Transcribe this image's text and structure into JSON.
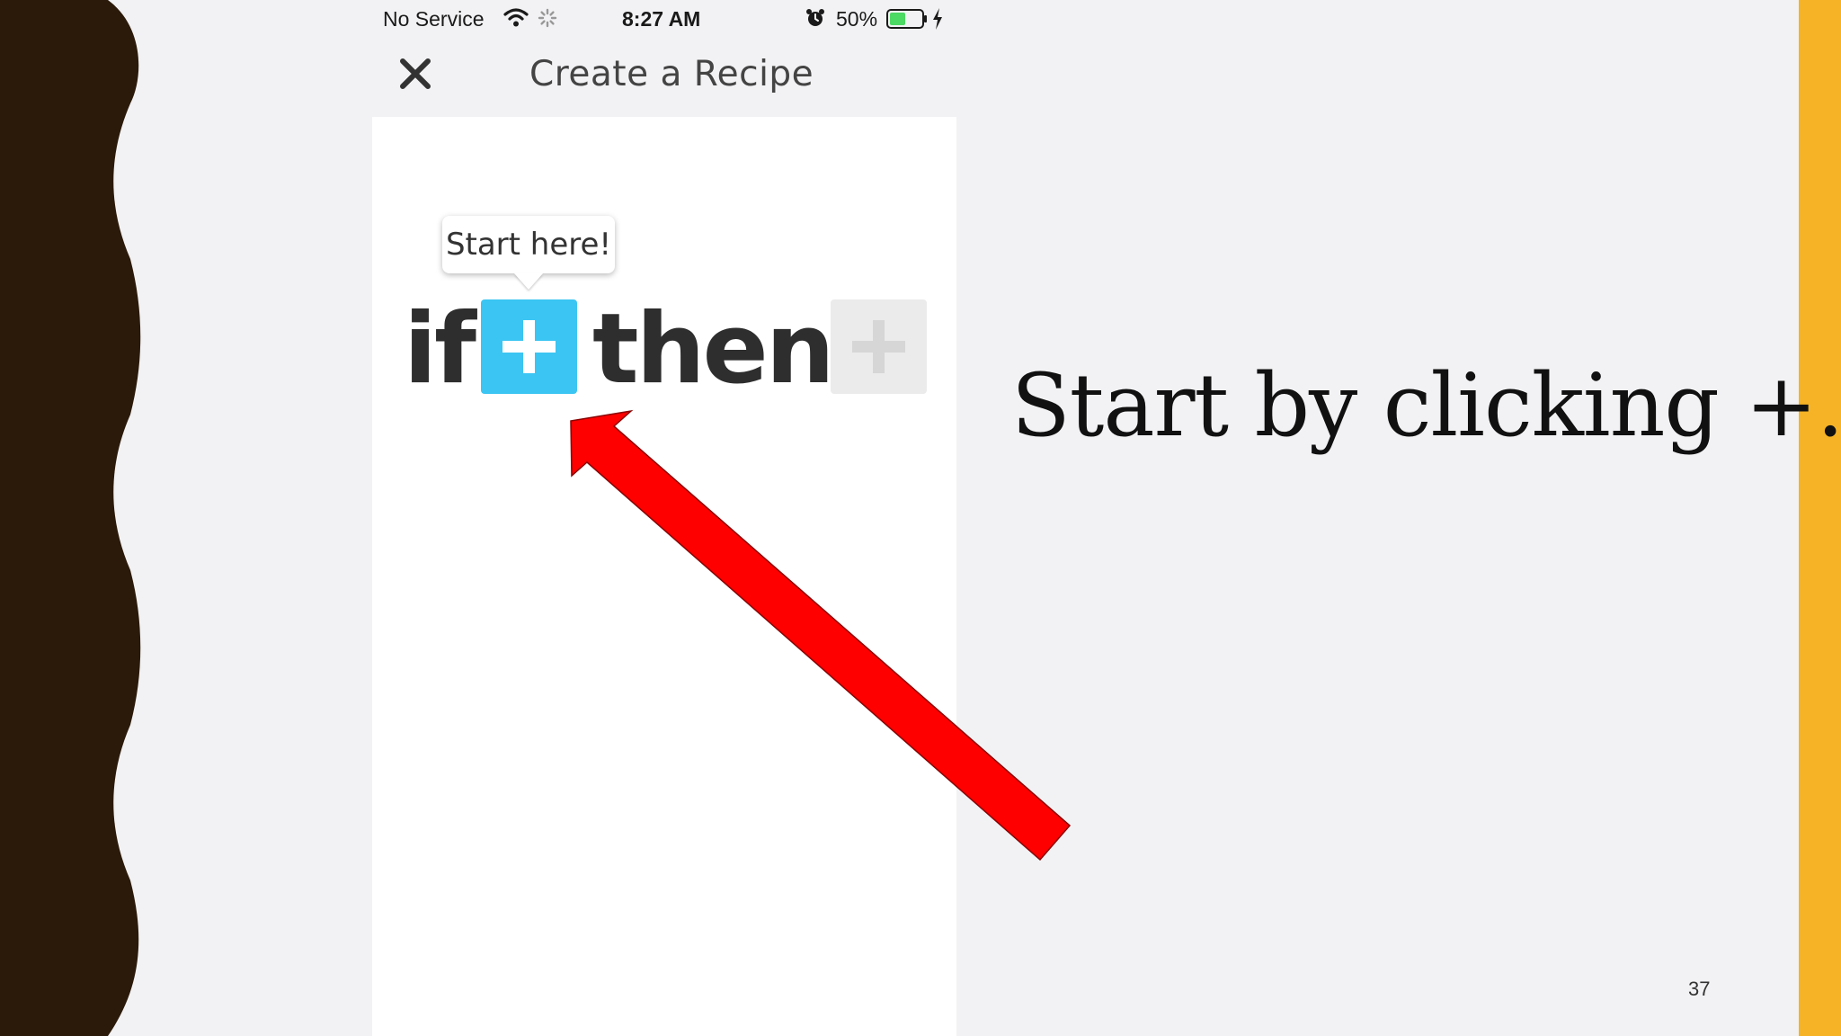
{
  "status_bar": {
    "carrier": "No Service",
    "time": "8:27 AM",
    "battery_percent": "50%",
    "battery_level": 0.5,
    "icons": [
      "wifi-icon",
      "loading-spinner-icon",
      "alarm-icon",
      "battery-icon",
      "charging-bolt-icon"
    ]
  },
  "nav": {
    "title": "Create a Recipe",
    "close_icon": "close-icon"
  },
  "recipe": {
    "tooltip": "Start here!",
    "if_word": "if",
    "then_word": "then",
    "trigger_icon": "plus-icon",
    "action_icon": "plus-icon"
  },
  "slide": {
    "caption": "Start by clicking +.",
    "page_number": "37"
  },
  "colors": {
    "accent_blue": "#3bc5f3",
    "arrow_red": "#ff0000",
    "border_brown": "#2b1a0a",
    "stripe_yellow": "#f5b325",
    "battery_green": "#4cd964"
  }
}
